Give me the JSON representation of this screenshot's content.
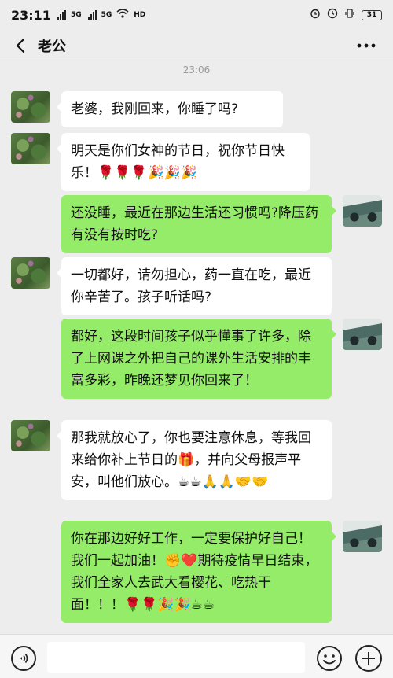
{
  "status_bar": {
    "time": "23:11",
    "signal1_label": "5G",
    "signal2_label": "5G",
    "wifi_icon": "wifi-icon",
    "extra_label": "HD",
    "battery": "31"
  },
  "header": {
    "back_icon": "chevron-left-icon",
    "title": "老公",
    "more_icon": "more-dots-icon"
  },
  "chat": {
    "timestamp": "23:06",
    "messages": [
      {
        "side": "left",
        "avatar": "plant-avatar",
        "text": "老婆，我刚回来，你睡了吗?"
      },
      {
        "side": "left",
        "avatar": "plant-avatar",
        "text": "明天是你们女神的节日，祝你节日快乐！🌹🌹🌹🎉🎉🎉"
      },
      {
        "side": "right",
        "avatar": "car-avatar",
        "text": "还没睡，最近在那边生活还习惯吗?降压药有没有按时吃?"
      },
      {
        "side": "left",
        "avatar": "plant-avatar",
        "text": "一切都好，请勿担心，药一直在吃，最近你辛苦了。孩子听话吗?"
      },
      {
        "side": "right",
        "avatar": "car-avatar",
        "text": "都好，这段时间孩子似乎懂事了许多，除了上网课之外把自己的课外生活安排的丰富多彩，昨晚还梦见你回来了！"
      },
      {
        "side": "left",
        "avatar": "plant-avatar",
        "text": "那我就放心了，你也要注意休息，等我回来给你补上节日的🎁，并向父母报声平安，叫他们放心。☕☕🙏🙏🤝🤝"
      },
      {
        "side": "right",
        "avatar": "car-avatar",
        "text": "你在那边好好工作，一定要保护好自己！我们一起加油！✊❤️期待疫情早日结束，我们全家人去武大看樱花、吃热干面！！！🌹🌹🎉🎉☕☕"
      }
    ]
  },
  "input_bar": {
    "voice_icon": "voice-icon",
    "input_value": "",
    "input_placeholder": "",
    "emoji_icon": "emoji-icon",
    "plus_icon": "plus-icon"
  }
}
